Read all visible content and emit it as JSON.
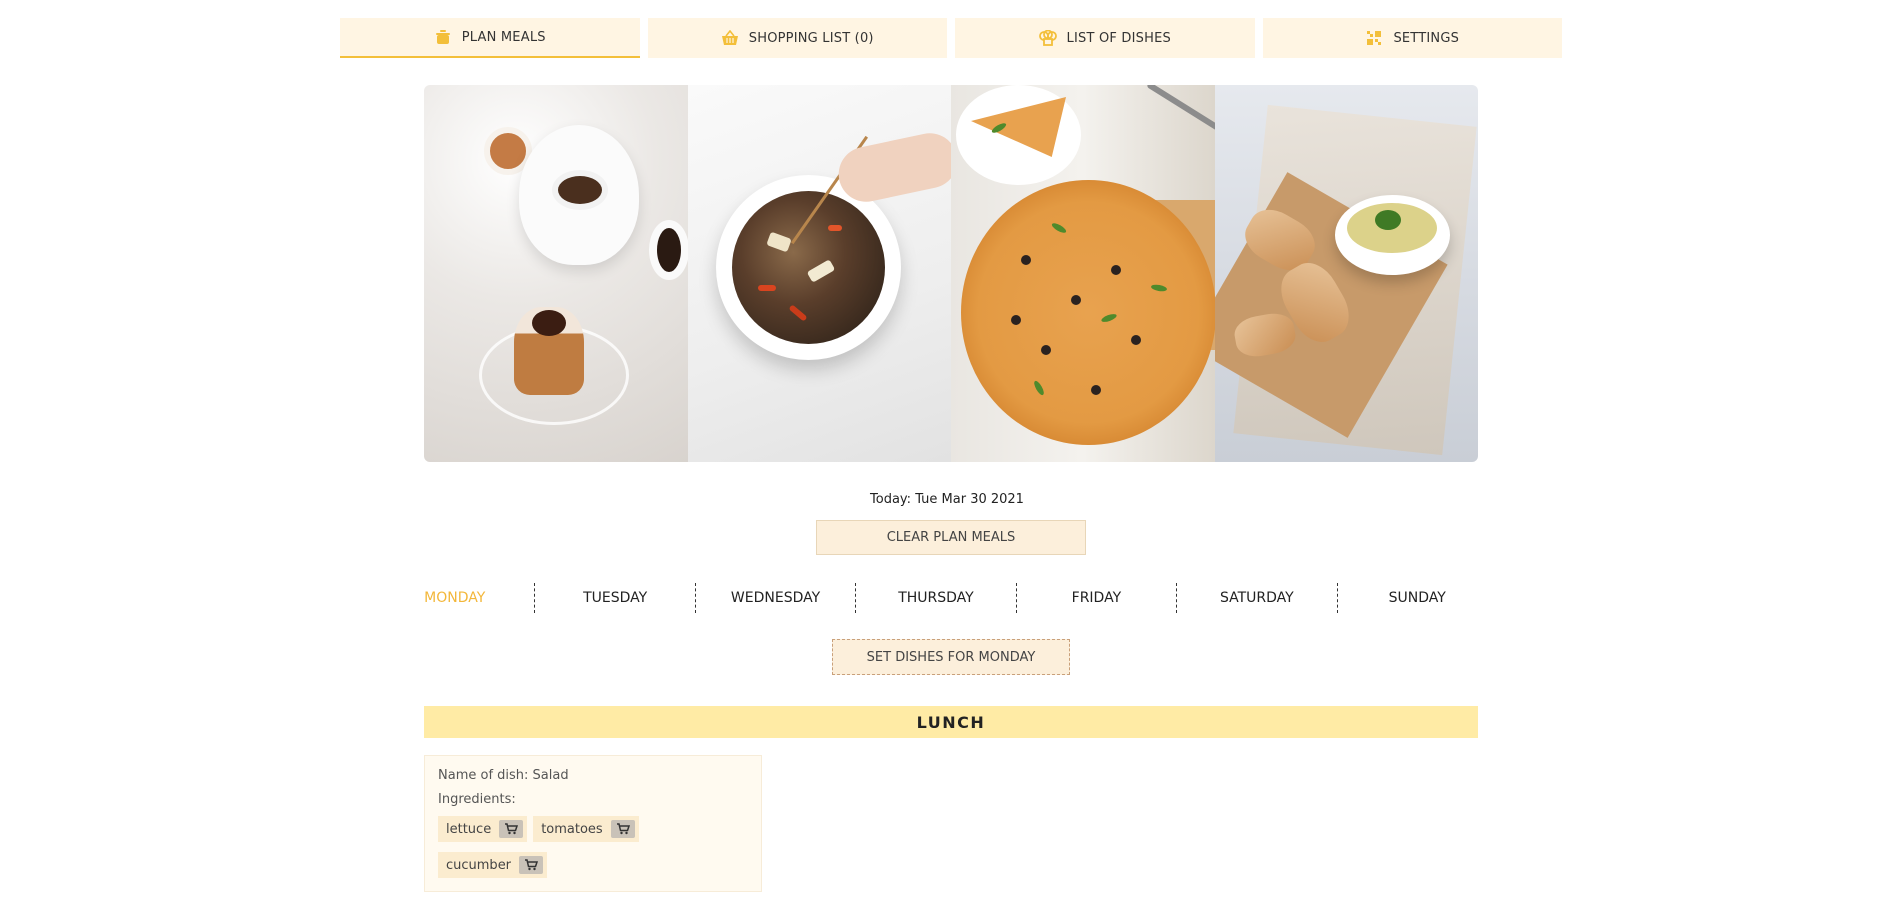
{
  "nav": {
    "tabs": [
      {
        "label": "PLAN MEALS",
        "icon": "pot-icon"
      },
      {
        "label": "SHOPPING LIST (0)",
        "icon": "basket-icon"
      },
      {
        "label": "LIST OF DISHES",
        "icon": "chef-hat-icon"
      },
      {
        "label": "SETTINGS",
        "icon": "settings-grid-icon"
      }
    ],
    "active_index": 0,
    "accent_color": "#f3bf3a"
  },
  "hero": {
    "images": [
      "tea-and-cupcakes-photo",
      "noodles-bowl-photo",
      "pizza-photo",
      "soup-and-bread-photo"
    ]
  },
  "today": "Today: Tue Mar 30 2021",
  "clear_button": "CLEAR PLAN MEALS",
  "days": [
    "MONDAY",
    "TUESDAY",
    "WEDNESDAY",
    "THURSDAY",
    "FRIDAY",
    "SATURDAY",
    "SUNDAY"
  ],
  "active_day": "MONDAY",
  "set_dishes_button": "SET DISHES FOR MONDAY",
  "meal": {
    "title": "LUNCH",
    "dish": {
      "name_line": "Name of dish: Salad",
      "ingredients_label": "Ingredients:",
      "ingredients": [
        "lettuce",
        "tomatoes",
        "cucumber"
      ]
    }
  }
}
